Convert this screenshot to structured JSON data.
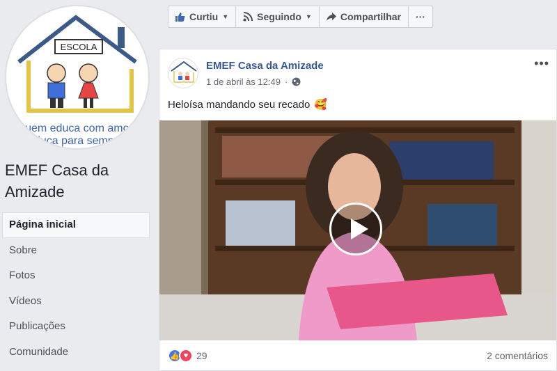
{
  "sidebar": {
    "page_name": "EMEF Casa da Amizade",
    "avatar_sign": "ESCOLA",
    "avatar_slogan_1": "quem educa com amor",
    "avatar_slogan_2": "educa para sempre",
    "nav": [
      {
        "label": "Página inicial",
        "active": true
      },
      {
        "label": "Sobre"
      },
      {
        "label": "Fotos"
      },
      {
        "label": "Vídeos"
      },
      {
        "label": "Publicações"
      },
      {
        "label": "Comunidade"
      }
    ]
  },
  "actionbar": {
    "like": "Curtiu",
    "follow": "Seguindo",
    "share": "Compartilhar",
    "more": "···"
  },
  "post": {
    "author": "EMEF Casa da Amizade",
    "timestamp": "1 de abril às 12:49",
    "text": "Heloísa mandando seu recado",
    "emoji": "🥰",
    "reactions_count": "29",
    "comments": "2 comentários"
  }
}
